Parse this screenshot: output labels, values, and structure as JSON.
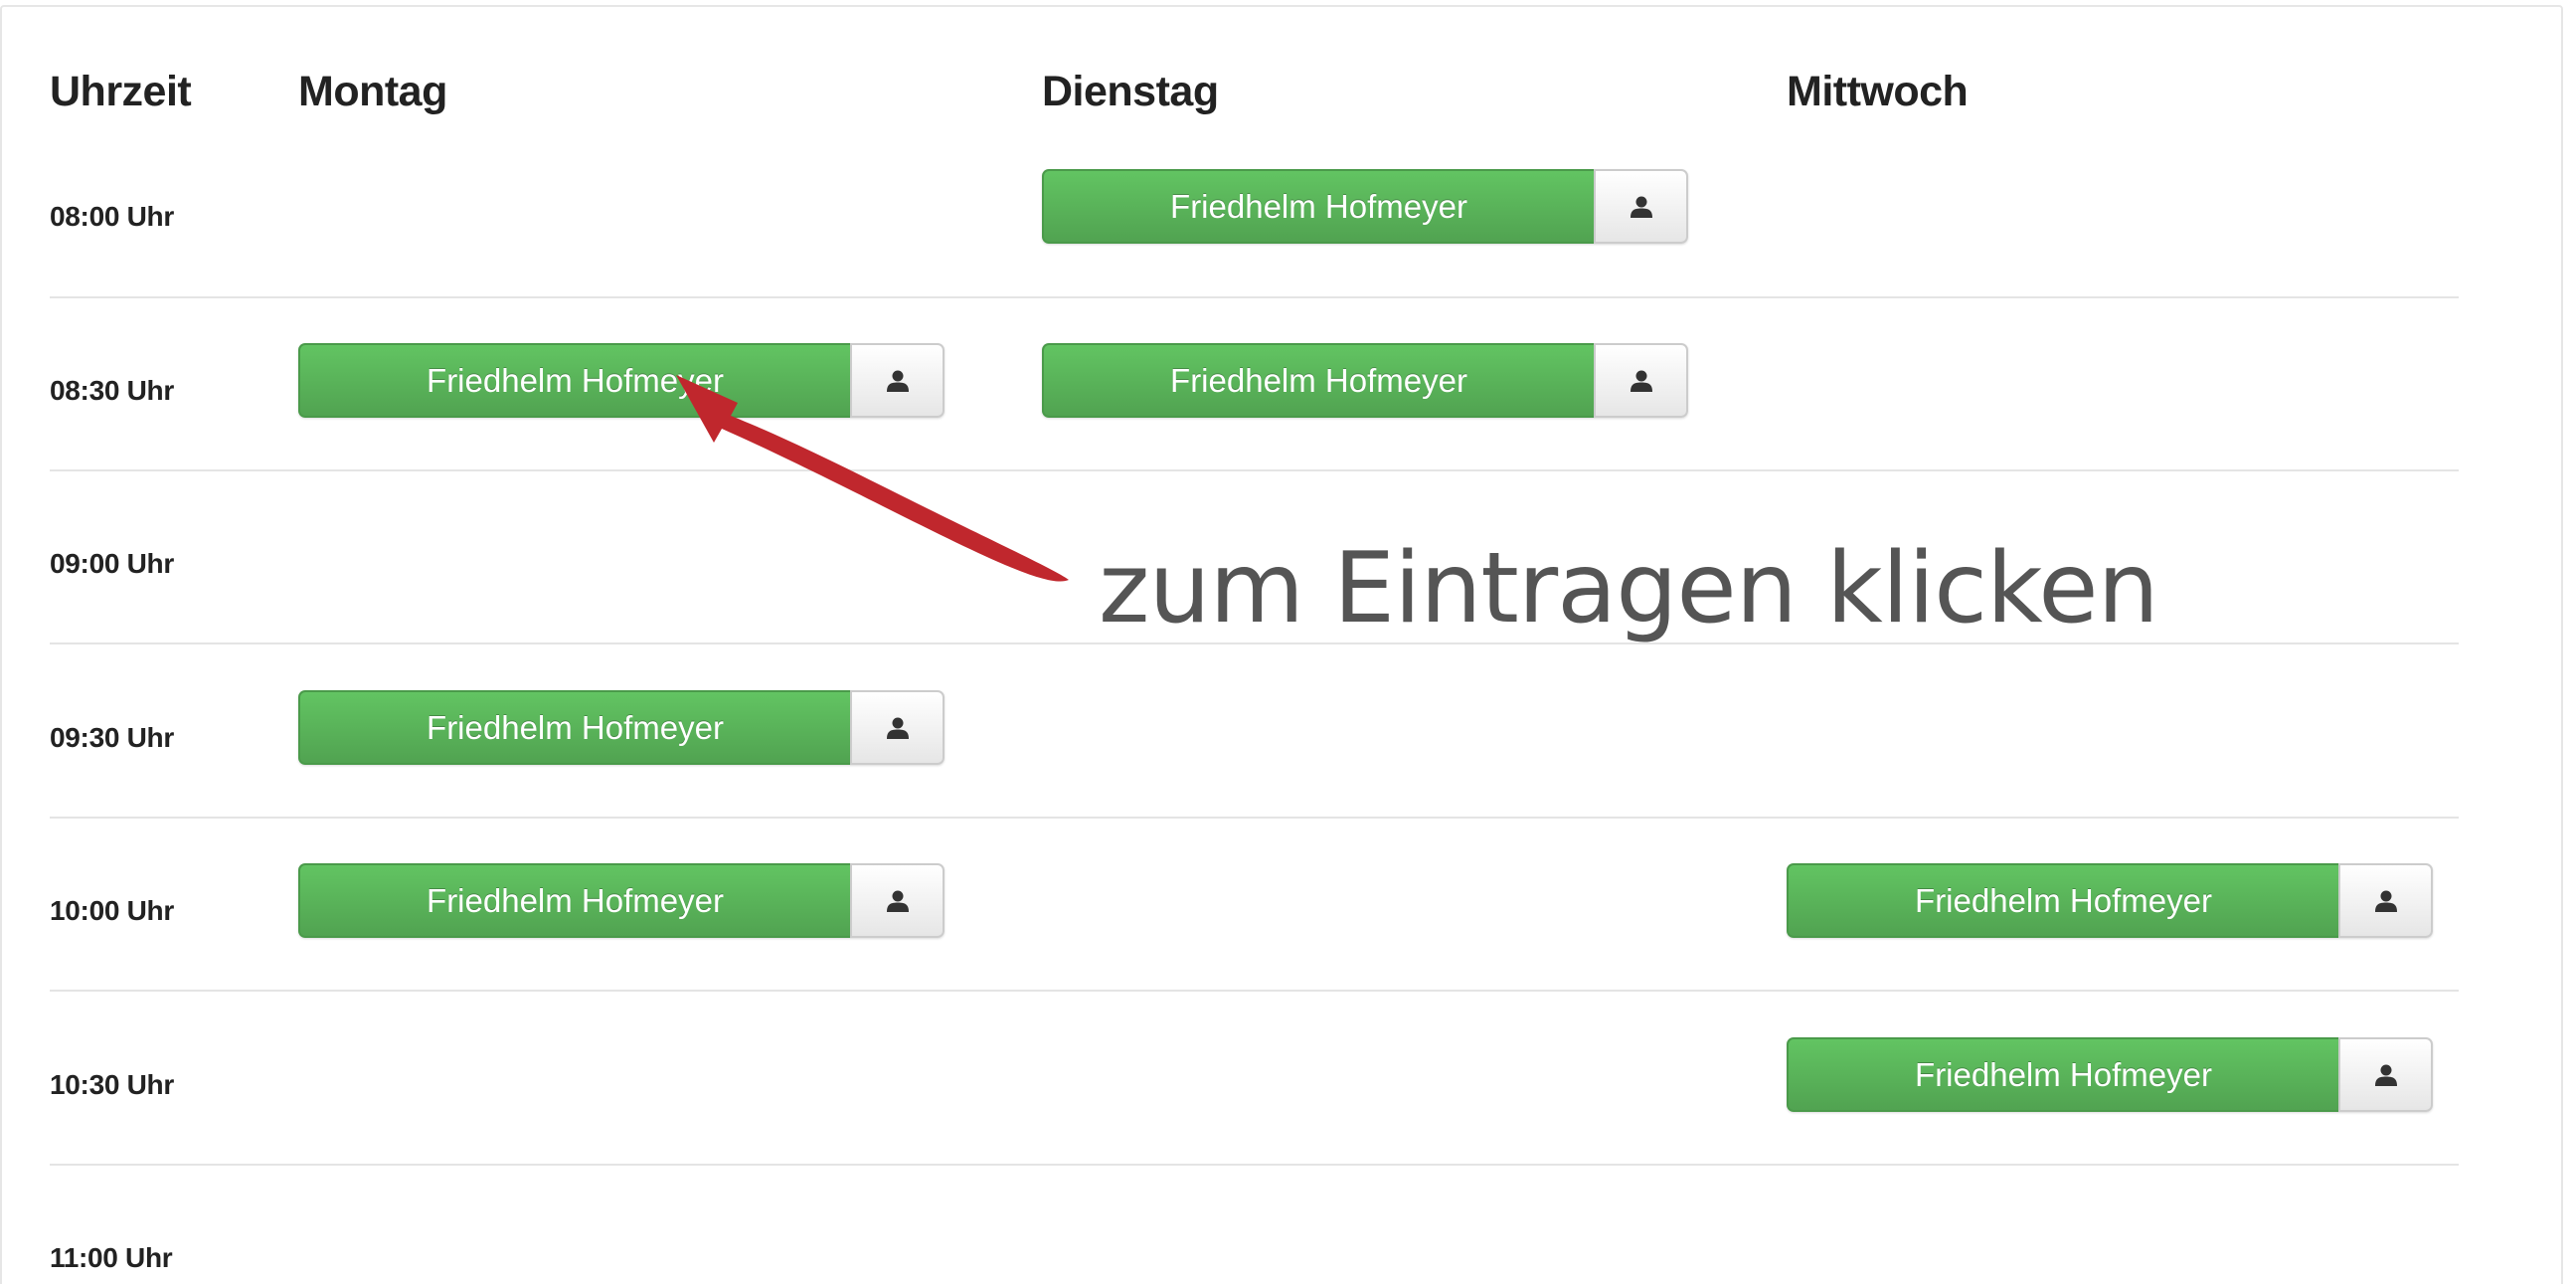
{
  "header": {
    "time_col": "Uhrzeit",
    "days": [
      "Montag",
      "Dienstag",
      "Mittwoch"
    ]
  },
  "times": [
    "08:00 Uhr",
    "08:30 Uhr",
    "09:00 Uhr",
    "09:30 Uhr",
    "10:00 Uhr",
    "10:30 Uhr",
    "11:00 Uhr"
  ],
  "slots": {
    "mon_0830": "Friedhelm Hofmeyer",
    "mon_0930": "Friedhelm Hofmeyer",
    "mon_1000": "Friedhelm Hofmeyer",
    "tue_0800": "Friedhelm Hofmeyer",
    "tue_0830": "Friedhelm Hofmeyer",
    "wed_1000": "Friedhelm Hofmeyer",
    "wed_1030": "Friedhelm Hofmeyer"
  },
  "annotation": {
    "text": "zum Eintragen klicken",
    "arrow_color": "#c0272d"
  },
  "icons": {
    "slot_icon": "user-icon"
  },
  "colors": {
    "button_green": "#5bb75b",
    "text": "#222222"
  }
}
